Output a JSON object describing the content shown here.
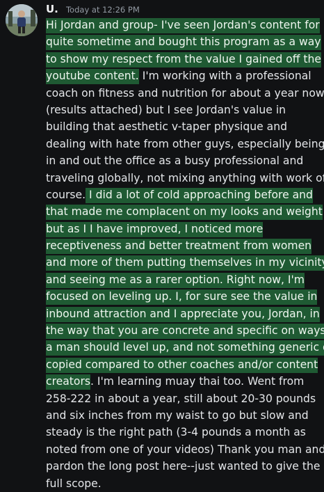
{
  "message": {
    "username": "U.",
    "timestamp": "Today at 12:26 PM",
    "lines": [
      {
        "hl": "Hi Jordan and group- I've seen Jordan's content for",
        "plain": ""
      },
      {
        "hl": "quite sometime and bought this program as a way",
        "plain": ""
      },
      {
        "hl": "to show my respect from the value I gained off the",
        "plain": ""
      },
      {
        "hl": "youtube content.",
        "plain": " I'm working with a professional"
      },
      {
        "hl": "",
        "plain": "coach on fitness and nutrition for about a year now"
      },
      {
        "hl": "",
        "plain": "(results attached) but I see Jordan's value in"
      },
      {
        "hl": "",
        "plain": "building that aesthetic v-taper physique and"
      },
      {
        "hl": "",
        "plain": "dealing with hate from other guys, especially being"
      },
      {
        "hl": "",
        "plain": "in and out the office as a busy professional and"
      },
      {
        "hl": "",
        "plain": "traveling globally, not mixing anything with work of"
      },
      {
        "pre": "course.",
        "hl": " I did a lot of cold approaching before and",
        "plain": ""
      },
      {
        "hl": "that made me complacent on my looks and weight",
        "plain": ""
      },
      {
        "hl": "but as I I have improved, I noticed more",
        "plain": ""
      },
      {
        "hl": "receptiveness and better treatment from women",
        "plain": ""
      },
      {
        "hl": "and more of them putting themselves in my vicinity",
        "plain": ""
      },
      {
        "hl": "and seeing me as a rarer option. Right now, I'm",
        "plain": ""
      },
      {
        "hl": "focused on leveling up. I, for sure see the value in",
        "plain": ""
      },
      {
        "hl": "inbound attraction and I appreciate you, Jordan, in",
        "plain": ""
      },
      {
        "hl": "the way that you are concrete and specific on ways",
        "plain": ""
      },
      {
        "hl": "a man should level up, and not something generic or",
        "plain": ""
      },
      {
        "hl": "copied compared to other coaches and/or content",
        "plain": ""
      },
      {
        "hl": "creators",
        "plain": ". I'm learning muay thai too. Went from"
      },
      {
        "hl": "",
        "plain": "258-222 in about a year, still about 20-30 pounds"
      },
      {
        "hl": "",
        "plain": "and six inches from my waist to go but slow and"
      },
      {
        "hl": "",
        "plain": "steady is the right path (3-4 pounds a month as"
      },
      {
        "hl": "",
        "plain": "noted from one of your videos) Thank you man and"
      },
      {
        "hl": "",
        "plain": "pardon the long post here--just wanted to give the"
      },
      {
        "hl": "",
        "plain": "full scope."
      }
    ]
  },
  "colors": {
    "background": "#111214",
    "highlight": "#1f5a33",
    "text": "#e4e6e9",
    "timestamp": "#949ba4"
  }
}
